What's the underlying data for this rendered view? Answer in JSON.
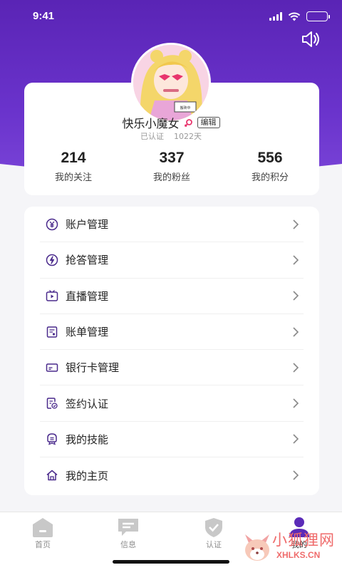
{
  "status_bar": {
    "time": "9:41"
  },
  "profile": {
    "name": "快乐小魔女",
    "edit_label": "编辑",
    "verified": "已认证",
    "days": "1022天"
  },
  "stats": [
    {
      "value": "214",
      "label": "我的关注"
    },
    {
      "value": "337",
      "label": "我的粉丝"
    },
    {
      "value": "556",
      "label": "我的积分"
    }
  ],
  "menu": [
    {
      "label": "账户管理",
      "icon": "yuan-coin-icon"
    },
    {
      "label": "抢答管理",
      "icon": "lightning-icon"
    },
    {
      "label": "直播管理",
      "icon": "tv-play-icon"
    },
    {
      "label": "账单管理",
      "icon": "bill-icon"
    },
    {
      "label": "银行卡管理",
      "icon": "bank-card-icon"
    },
    {
      "label": "签约认证",
      "icon": "contract-check-icon"
    },
    {
      "label": "我的技能",
      "icon": "skill-badge-icon"
    },
    {
      "label": "我的主页",
      "icon": "house-icon"
    }
  ],
  "tabs": [
    {
      "label": "首页",
      "icon": "home-icon"
    },
    {
      "label": "信息",
      "icon": "message-icon"
    },
    {
      "label": "认证",
      "icon": "shield-check-icon"
    },
    {
      "label": "我的",
      "icon": "person-icon",
      "active": true
    }
  ],
  "watermark": {
    "text": "小狐狸网",
    "url": "XHLKS.CN"
  },
  "colors": {
    "brand": "#5a24b5",
    "active_tab": "#5b2bb8",
    "inactive_tab": "#c8c8c8"
  }
}
